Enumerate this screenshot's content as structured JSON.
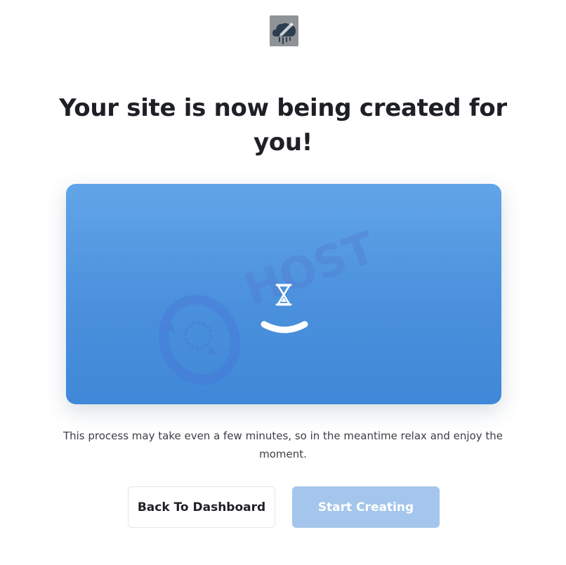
{
  "logo": {
    "icon": "cloud-pen-logo-icon",
    "color": "#8e9297"
  },
  "headline": "Your site is now being created for you!",
  "loader": {
    "icon": "hourglass-icon",
    "spinner_icon": "loading-arc-icon",
    "background_colors": [
      "#62a5e8",
      "#4088d8"
    ]
  },
  "watermark_text": "HOST",
  "description": "This process may take even a few minutes, so in the meantime relax and enjoy the moment.",
  "buttons": {
    "back_label": "Back To Dashboard",
    "start_label": "Start Creating",
    "start_color": "#a4c6ec"
  }
}
